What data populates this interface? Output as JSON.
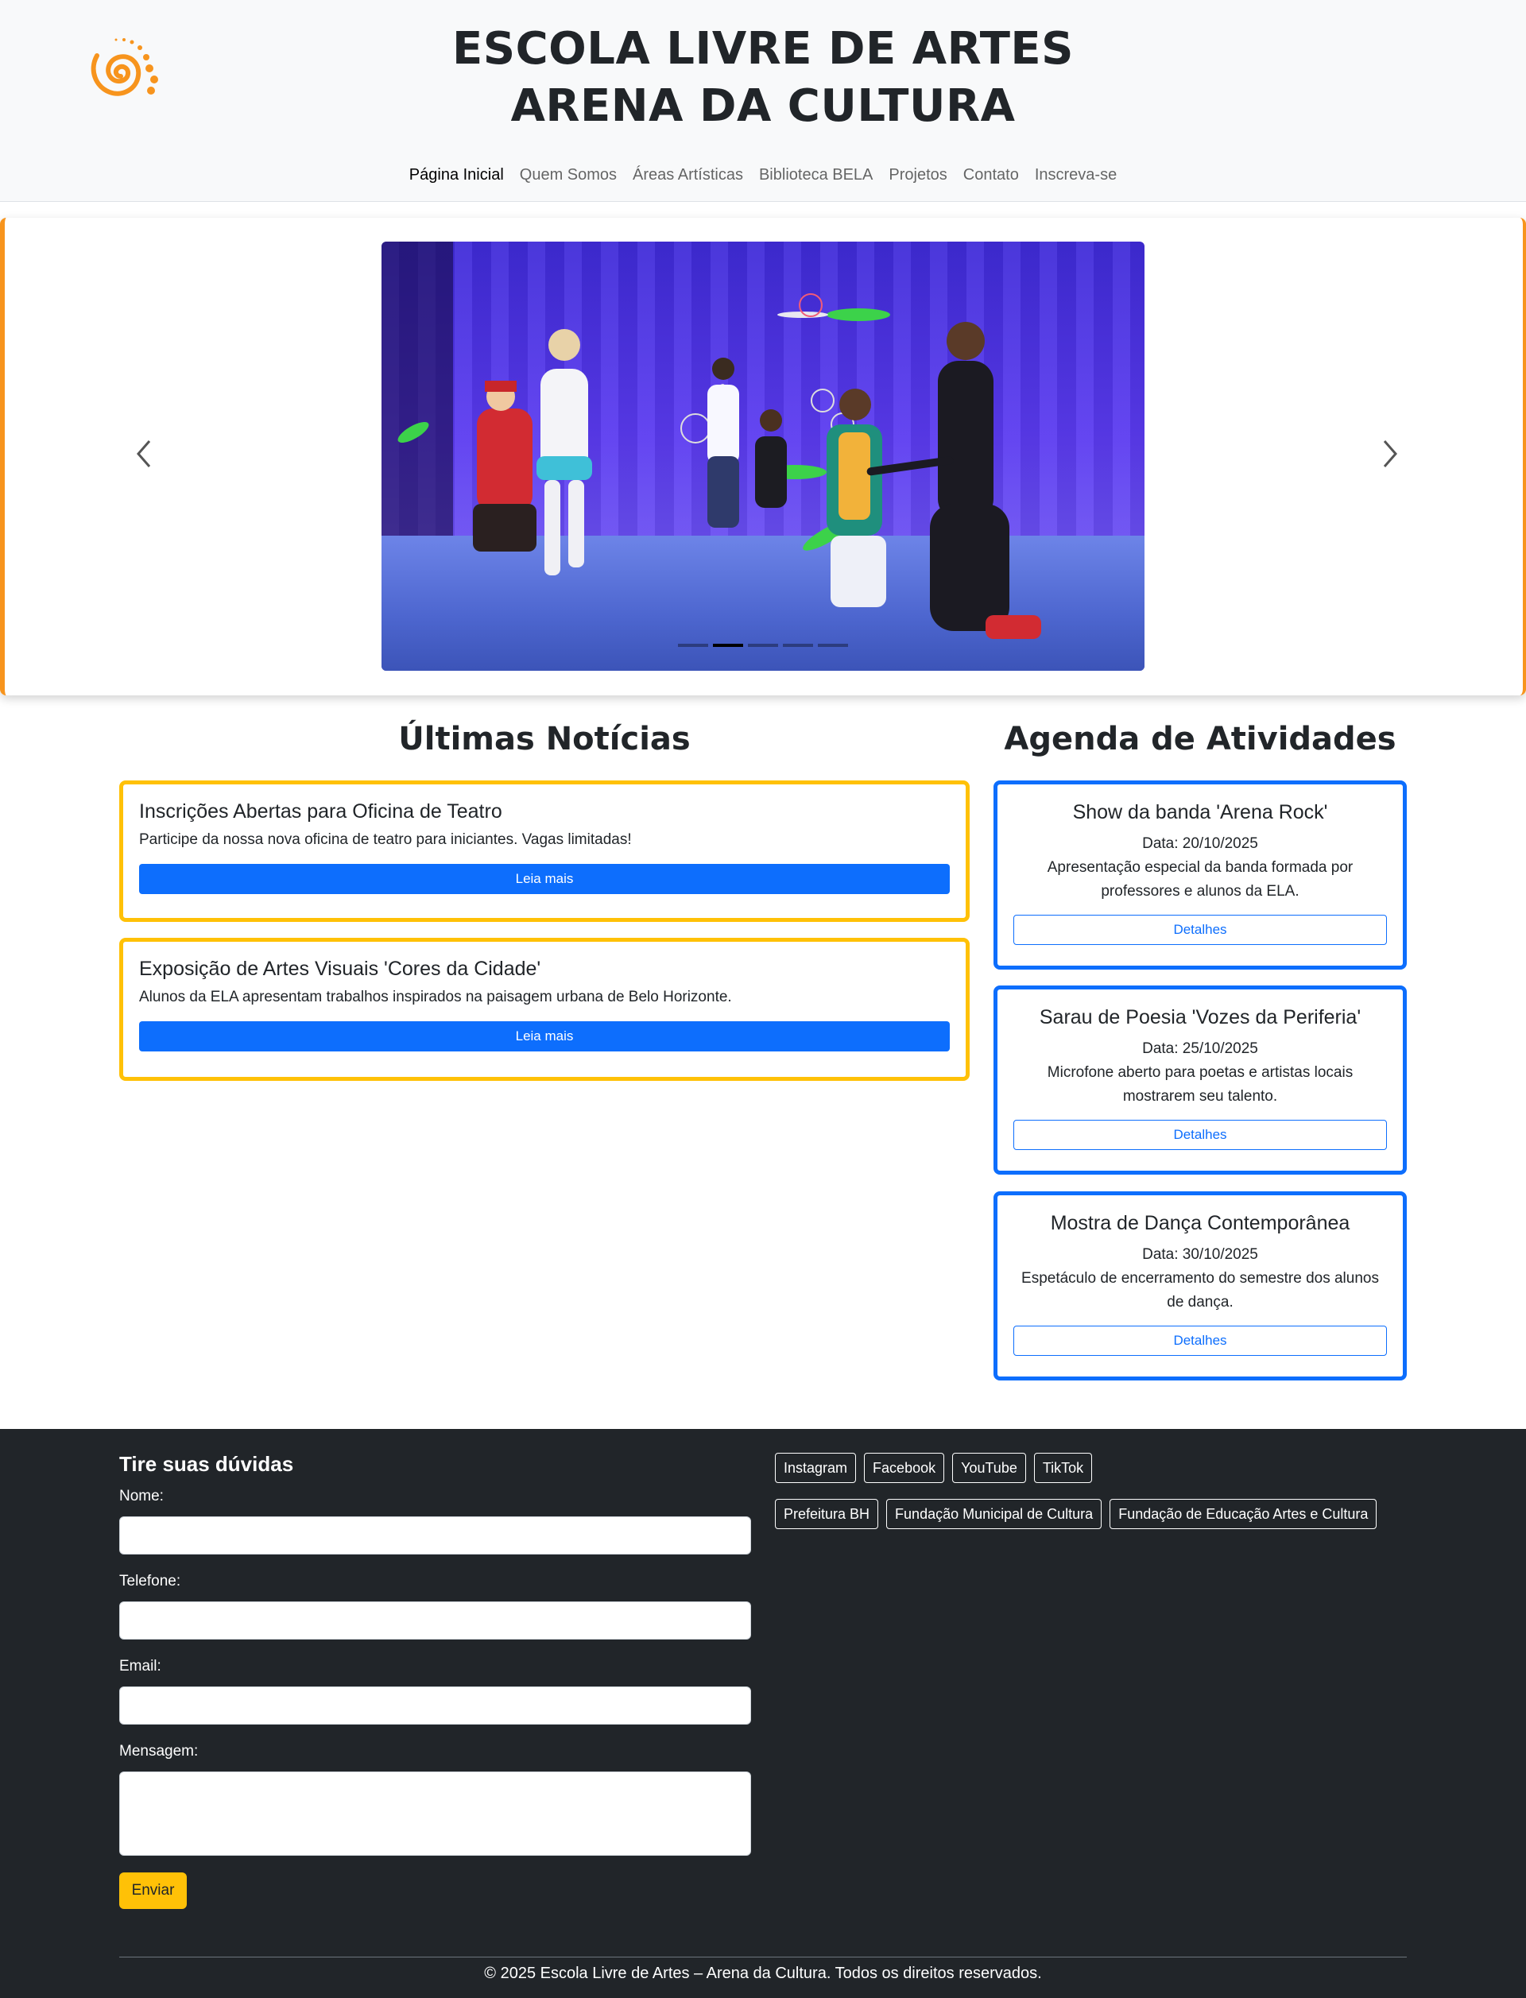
{
  "header": {
    "title_line1": "ESCOLA LIVRE DE ARTES",
    "title_line2": "ARENA DA CULTURA",
    "logo_icon": "spiral-logo-icon",
    "brand_color": "#f7941d"
  },
  "nav": {
    "items": [
      {
        "label": "Página Inicial",
        "active": true
      },
      {
        "label": "Quem Somos"
      },
      {
        "label": "Áreas Artísticas"
      },
      {
        "label": "Biblioteca BELA"
      },
      {
        "label": "Projetos"
      },
      {
        "label": "Contato"
      },
      {
        "label": "Inscreva-se"
      }
    ]
  },
  "carousel": {
    "slide_count": 5,
    "active_index": 1,
    "prev_icon": "chevron-left-icon",
    "next_icon": "chevron-right-icon"
  },
  "news": {
    "title": "Últimas Notícias",
    "items": [
      {
        "title": "Inscrições Abertas para Oficina de Teatro",
        "text": "Participe da nossa nova oficina de teatro para iniciantes. Vagas limitadas!",
        "button": "Leia mais"
      },
      {
        "title": "Exposição de Artes Visuais 'Cores da Cidade'",
        "text": "Alunos da ELA apresentam trabalhos inspirados na paisagem urbana de Belo Horizonte.",
        "button": "Leia mais"
      }
    ]
  },
  "agenda": {
    "title": "Agenda de Atividades",
    "items": [
      {
        "title": "Show da banda 'Arena Rock'",
        "date": "Data: 20/10/2025",
        "text": "Apresentação especial da banda formada por professores e alunos da ELA.",
        "button": "Detalhes"
      },
      {
        "title": "Sarau de Poesia 'Vozes da Periferia'",
        "date": "Data: 25/10/2025",
        "text": "Microfone aberto para poetas e artistas locais mostrarem seu talento.",
        "button": "Detalhes"
      },
      {
        "title": "Mostra de Dança Contemporânea",
        "date": "Data: 30/10/2025",
        "text": "Espetáculo de encerramento do semestre dos alunos de dança.",
        "button": "Detalhes"
      }
    ]
  },
  "footer": {
    "form": {
      "title": "Tire suas dúvidas",
      "name_label": "Nome:",
      "phone_label": "Telefone:",
      "email_label": "Email:",
      "message_label": "Mensagem:",
      "submit": "Enviar"
    },
    "social": [
      "Instagram",
      "Facebook",
      "YouTube",
      "TikTok"
    ],
    "partners": [
      "Prefeitura BH",
      "Fundação Municipal de Cultura",
      "Fundação de Educação Artes e Cultura"
    ],
    "copyright": "© 2025 Escola Livre de Artes – Arena da Cultura. Todos os direitos reservados."
  }
}
